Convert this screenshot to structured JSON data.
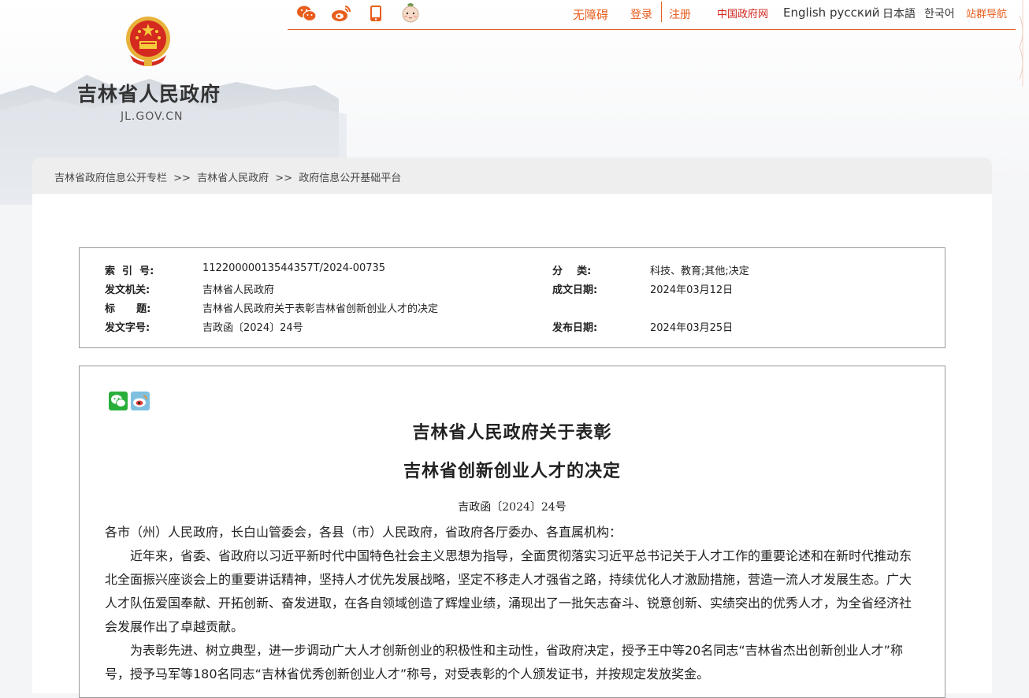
{
  "header": {
    "site_title": "吉林省人民政府",
    "site_domain": "JL.GOV.CN",
    "social": [
      "wechat-icon",
      "weibo-icon",
      "mobile-icon",
      "mascot-icon"
    ],
    "nav": {
      "accessibility": "无障碍",
      "login": "登录",
      "register": "注册",
      "gov_portal": "中国政府网",
      "english": "English",
      "russian": "русский",
      "japanese": "日本語",
      "korean": "한국어",
      "site_nav": "站群导航"
    }
  },
  "breadcrumb": [
    "吉林省政府信息公开专栏",
    ">>",
    "吉林省人民政府",
    ">>",
    "政府信息公开基础平台"
  ],
  "meta": {
    "index_label": "索  引  号:",
    "index_value": "11220000013544357T/2024-00735",
    "category_label": "分    类:",
    "category_value": "科技、教育;其他;决定",
    "issuer_label": "发文机关:",
    "issuer_value": "吉林省人民政府",
    "created_label": "成文日期:",
    "created_value": "2024年03月12日",
    "title_label": "标      题:",
    "title_value": "吉林省人民政府关于表彰吉林省创新创业人才的决定",
    "docno_label": "发文字号:",
    "docno_value": "吉政函〔2024〕24号",
    "published_label": "发布日期:",
    "published_value": "2024年03月25日"
  },
  "article": {
    "share": [
      "wechat-share-icon",
      "weibo-share-icon"
    ],
    "title_line1": "吉林省人民政府关于表彰",
    "title_line2": "吉林省创新创业人才的决定",
    "doc_number": "吉政函〔2024〕24号",
    "salutation": "各市（州）人民政府，长白山管委会，各县（市）人民政府，省政府各厅委办、各直属机构：",
    "para1": "近年来，省委、省政府以习近平新时代中国特色社会主义思想为指导，全面贯彻落实习近平总书记关于人才工作的重要论述和在新时代推动东北全面振兴座谈会上的重要讲话精神，坚持人才优先发展战略，坚定不移走人才强省之路，持续优化人才激励措施，营造一流人才发展生态。广大人才队伍爱国奉献、开拓创新、奋发进取，在各自领域创造了辉煌业绩，涌现出了一批矢志奋斗、锐意创新、实绩突出的优秀人才，为全省经济社会发展作出了卓越贡献。",
    "para2": "为表彰先进、树立典型，进一步调动广大人才创新创业的积极性和主动性，省政府决定，授予王中等20名同志“吉林省杰出创新创业人才”称号，授予马军等180名同志“吉林省优秀创新创业人才”称号，对受表彰的个人颁发证书，并按规定发放奖金。"
  }
}
